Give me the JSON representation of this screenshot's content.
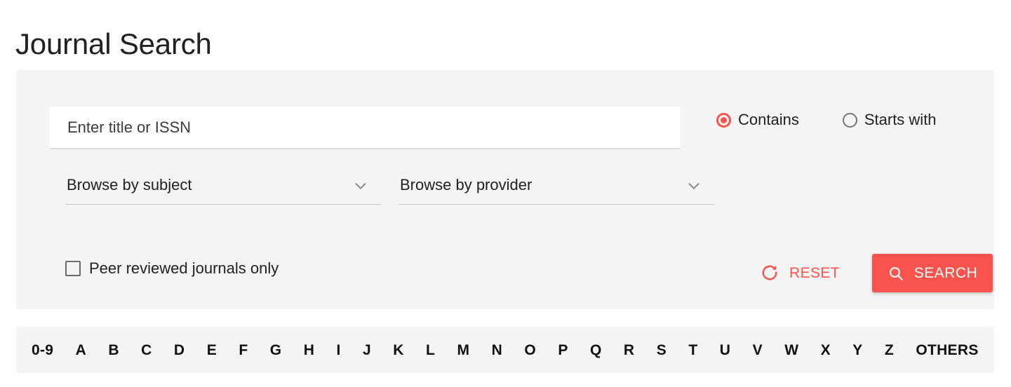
{
  "page": {
    "title": "Journal Search"
  },
  "search_form": {
    "query_input": {
      "placeholder": "Enter title or ISSN",
      "value": ""
    },
    "match_mode": {
      "selected": "Contains",
      "options": [
        {
          "label": "Contains",
          "selected": true
        },
        {
          "label": "Starts with",
          "selected": false
        }
      ]
    },
    "subject_select": {
      "value": "Browse by subject"
    },
    "provider_select": {
      "value": "Browse by provider"
    },
    "peer_reviewed_checkbox": {
      "label": "Peer reviewed journals only",
      "checked": false
    },
    "reset_button": {
      "label": "RESET",
      "icon": "refresh-icon"
    },
    "search_button": {
      "label": "SEARCH",
      "icon": "search-icon"
    }
  },
  "alphabet_bar": {
    "items": [
      "0-9",
      "A",
      "B",
      "C",
      "D",
      "E",
      "F",
      "G",
      "H",
      "I",
      "J",
      "K",
      "L",
      "M",
      "N",
      "O",
      "P",
      "Q",
      "R",
      "S",
      "T",
      "U",
      "V",
      "W",
      "X",
      "Y",
      "Z",
      "OTHERS"
    ]
  },
  "colors": {
    "accent": "#f9534d",
    "panel_background": "#f4f4f4",
    "page_background": "#ffffff",
    "text": "#202124"
  }
}
